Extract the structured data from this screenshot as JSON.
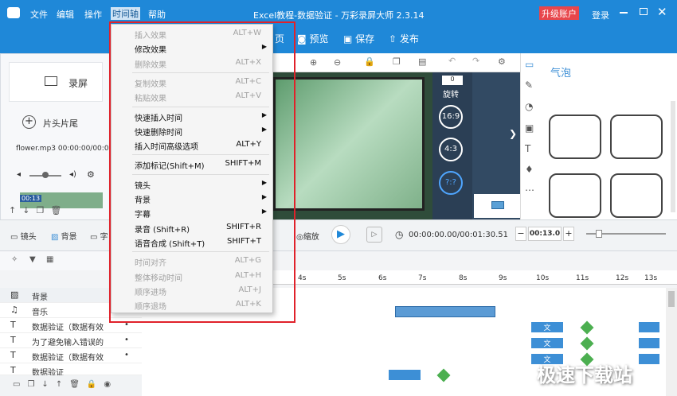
{
  "app": {
    "title": "Excel教程-数据验证 - 万彩录屏大师 2.3.14",
    "upgrade": "升级账户",
    "login": "登录"
  },
  "menubar": [
    "文件",
    "编辑",
    "操作",
    "时间轴",
    "帮助"
  ],
  "toolbar": {
    "home_suffix": "页",
    "preview": "预览",
    "save": "保存",
    "publish": "发布"
  },
  "left": {
    "record": "录屏",
    "intro": "片头片尾",
    "media_file": "flower.mp3 00:00:00/00:01:",
    "thumb_label": "00:13"
  },
  "context_menu": [
    {
      "label": "插入效果",
      "shortcut": "ALT+W",
      "enabled": false,
      "submenu": false
    },
    {
      "label": "修改效果",
      "shortcut": "",
      "enabled": true,
      "submenu": true
    },
    {
      "label": "删除效果",
      "shortcut": "ALT+X",
      "enabled": false,
      "submenu": false
    },
    {
      "sep": true
    },
    {
      "label": "复制效果",
      "shortcut": "ALT+C",
      "enabled": false,
      "submenu": false
    },
    {
      "label": "粘贴效果",
      "shortcut": "ALT+V",
      "enabled": false,
      "submenu": false
    },
    {
      "sep": true
    },
    {
      "label": "快速插入时间",
      "shortcut": "",
      "enabled": true,
      "submenu": true
    },
    {
      "label": "快速删除时间",
      "shortcut": "",
      "enabled": true,
      "submenu": true
    },
    {
      "label": "插入时间高级选项",
      "shortcut": "ALT+Y",
      "enabled": true,
      "submenu": false
    },
    {
      "sep": true
    },
    {
      "label": "添加标记(Shift+M)",
      "shortcut": "SHIFT+M",
      "enabled": true,
      "submenu": false
    },
    {
      "sep": true
    },
    {
      "label": "镜头",
      "shortcut": "",
      "enabled": true,
      "submenu": true
    },
    {
      "label": "背景",
      "shortcut": "",
      "enabled": true,
      "submenu": true
    },
    {
      "label": "字幕",
      "shortcut": "",
      "enabled": true,
      "submenu": true
    },
    {
      "label": "录音 (Shift+R)",
      "shortcut": "SHIFT+R",
      "enabled": true,
      "submenu": false
    },
    {
      "label": "语音合成 (Shift+T)",
      "shortcut": "SHIFT+T",
      "enabled": true,
      "submenu": false
    },
    {
      "sep": true
    },
    {
      "label": "时间对齐",
      "shortcut": "ALT+G",
      "enabled": false,
      "submenu": false
    },
    {
      "label": "整体移动时间",
      "shortcut": "ALT+H",
      "enabled": false,
      "submenu": false
    },
    {
      "label": "顺序进场",
      "shortcut": "ALT+J",
      "enabled": false,
      "submenu": false
    },
    {
      "label": "顺序退场",
      "shortcut": "ALT+K",
      "enabled": false,
      "submenu": false
    }
  ],
  "canvas_side": {
    "counter": "0",
    "rotate": "旋转",
    "ratio169": "16:9",
    "ratio43": "4:3",
    "custom": "?:?"
  },
  "right_panel": {
    "title": "气泡"
  },
  "timeline_tools": {
    "lens": "镜头",
    "background": "背景",
    "subtitle": "字",
    "scale": "缩放",
    "time": "00:00:00.00/00:01:30.51",
    "duration": "00:13.0"
  },
  "ruler": [
    "4s",
    "5s",
    "6s",
    "7s",
    "8s",
    "9s",
    "10s",
    "11s",
    "12s",
    "13s"
  ],
  "tracks": [
    {
      "icon": "▨",
      "label": "背景"
    },
    {
      "icon": "♫",
      "label": "音乐"
    },
    {
      "icon": "T",
      "label": "数据验证（数据有效"
    },
    {
      "icon": "T",
      "label": "为了避免输入错误的"
    },
    {
      "icon": "T",
      "label": "数据验证（数据有效"
    },
    {
      "icon": "T",
      "label": "数据验证"
    }
  ],
  "clips": {
    "text_clip": "文"
  },
  "watermark": "极速下载站",
  "colors": {
    "titlebar": "#1f88d8",
    "upgrade_bg": "#e8464b",
    "highlight_box": "#e0212a",
    "clip": "#3d8fd6"
  }
}
